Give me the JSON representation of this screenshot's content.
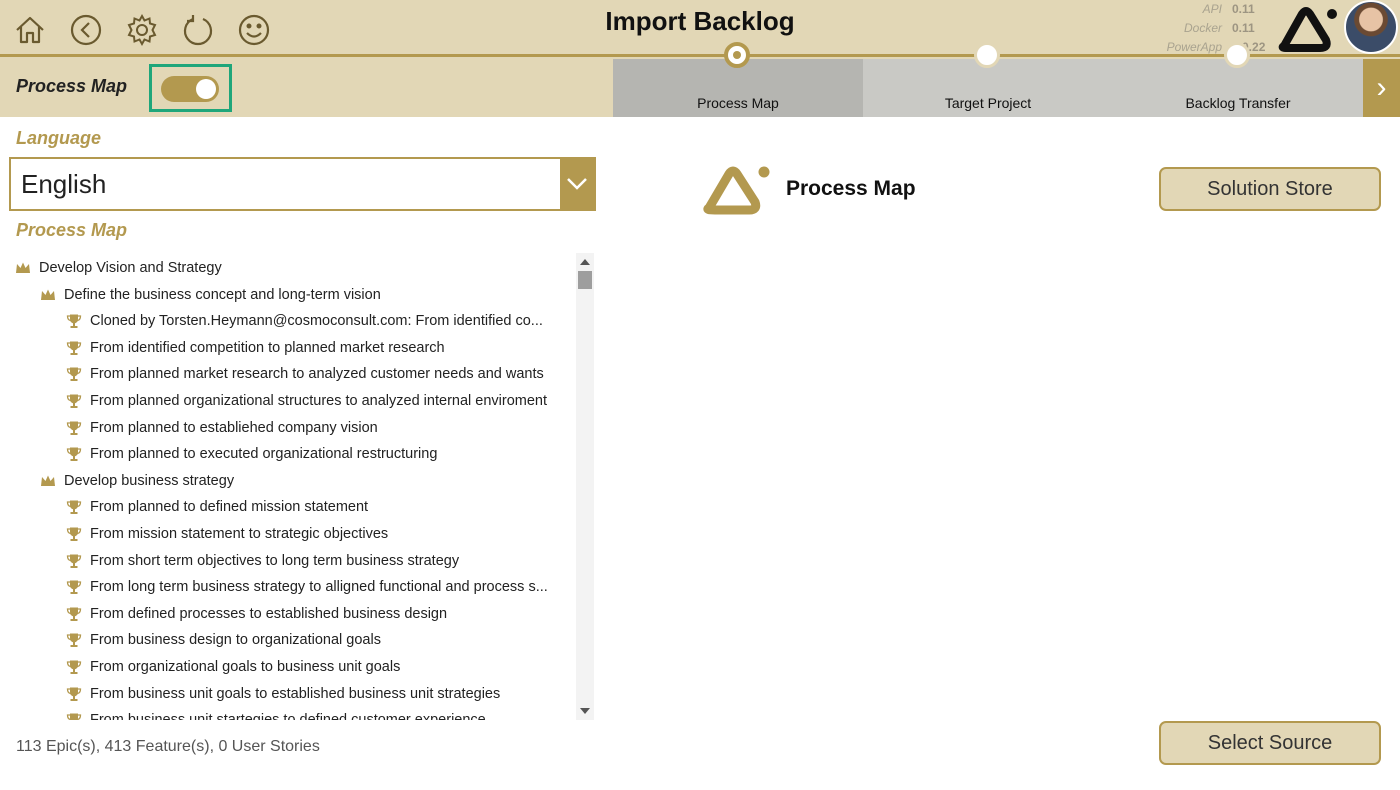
{
  "header": {
    "title": "Import Backlog",
    "nav": [
      "home-icon",
      "back-icon",
      "settings-icon",
      "refresh-icon",
      "smiley-icon"
    ],
    "versions": [
      {
        "label": "API",
        "value": "0.11"
      },
      {
        "label": "Docker",
        "value": "0.11"
      },
      {
        "label": "PowerApp",
        "value": "2.0.22"
      }
    ],
    "toggle_label": "Process Map",
    "toggle_on": true
  },
  "steps": [
    {
      "label": "Process Map",
      "active": true
    },
    {
      "label": "Target Project",
      "active": false
    },
    {
      "label": "Backlog Transfer",
      "active": false
    }
  ],
  "left": {
    "language_label": "Language",
    "language_value": "English",
    "process_map_label": "Process Map",
    "tree": [
      {
        "level": 0,
        "icon": "crown-icon",
        "text": "Develop Vision and Strategy"
      },
      {
        "level": 1,
        "icon": "crown-icon",
        "text": "Define the business concept and long-term vision"
      },
      {
        "level": 2,
        "icon": "trophy-icon",
        "text": "Cloned by Torsten.Heymann@cosmoconsult.com: From identified co..."
      },
      {
        "level": 2,
        "icon": "trophy-icon",
        "text": "From identified competition to planned market research"
      },
      {
        "level": 2,
        "icon": "trophy-icon",
        "text": "From planned market research to analyzed customer needs and wants"
      },
      {
        "level": 2,
        "icon": "trophy-icon",
        "text": "From planned organizational structures to analyzed internal enviroment"
      },
      {
        "level": 2,
        "icon": "trophy-icon",
        "text": "From planned to establiehed company vision"
      },
      {
        "level": 2,
        "icon": "trophy-icon",
        "text": "From planned to executed organizational restructuring"
      },
      {
        "level": 1,
        "icon": "crown-icon",
        "text": "Develop business strategy"
      },
      {
        "level": 2,
        "icon": "trophy-icon",
        "text": "From planned to defined mission statement"
      },
      {
        "level": 2,
        "icon": "trophy-icon",
        "text": "From mission statement to strategic objectives"
      },
      {
        "level": 2,
        "icon": "trophy-icon",
        "text": "From short term objectives to long term business strategy"
      },
      {
        "level": 2,
        "icon": "trophy-icon",
        "text": "From long term business strategy to alligned functional and process s..."
      },
      {
        "level": 2,
        "icon": "trophy-icon",
        "text": "From defined processes to established business design"
      },
      {
        "level": 2,
        "icon": "trophy-icon",
        "text": "From business design to organizational goals"
      },
      {
        "level": 2,
        "icon": "trophy-icon",
        "text": "From organizational goals to business unit goals"
      },
      {
        "level": 2,
        "icon": "trophy-icon",
        "text": "From business unit goals to established business unit strategies"
      },
      {
        "level": 2,
        "icon": "trophy-icon",
        "text": "From business unit startegies to defined customer experience"
      }
    ],
    "counts": "113 Epic(s), 413 Feature(s), 0 User Stories"
  },
  "right": {
    "title": "Process Map",
    "solution_store_label": "Solution Store",
    "select_source_label": "Select Source"
  },
  "colors": {
    "gold": "#b3994f",
    "header_bg": "#e2d7b6",
    "highlight": "#1fa67a"
  }
}
